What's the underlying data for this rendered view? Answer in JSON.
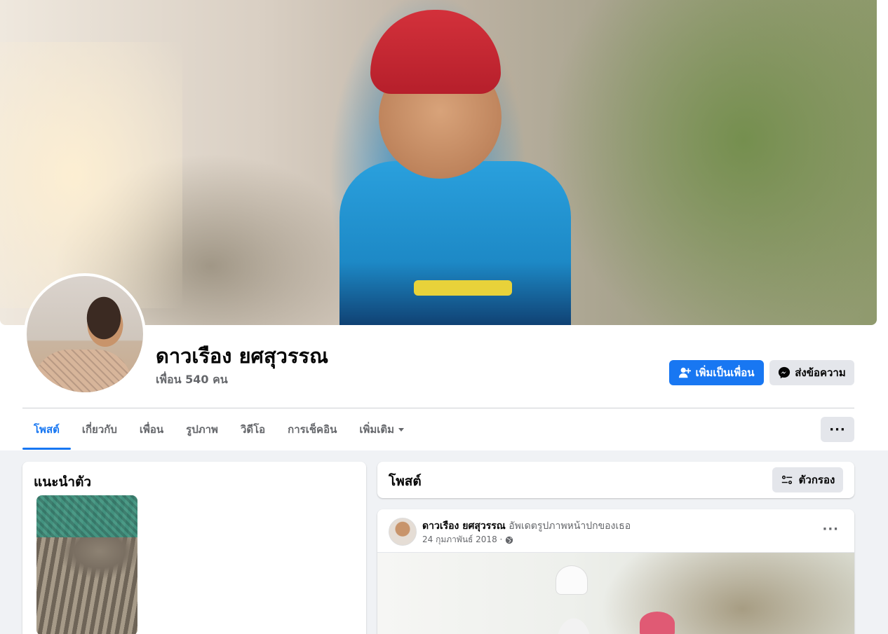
{
  "profile": {
    "name": "ดาวเรือง ยศสุวรรณ",
    "friends_label": "เพื่อน 540 คน"
  },
  "actions": {
    "add_friend": "เพิ่มเป็นเพื่อน",
    "message": "ส่งข้อความ"
  },
  "tabs": [
    {
      "label": "โพสต์",
      "active": true
    },
    {
      "label": "เกี่ยวกับ",
      "active": false
    },
    {
      "label": "เพื่อน",
      "active": false
    },
    {
      "label": "รูปภาพ",
      "active": false
    },
    {
      "label": "วิดีโอ",
      "active": false
    },
    {
      "label": "การเช็คอิน",
      "active": false
    },
    {
      "label": "เพิ่มเติม",
      "active": false
    }
  ],
  "more_button": "···",
  "intro": {
    "title": "แนะนำตัว"
  },
  "posts": {
    "title": "โพสต์",
    "filter_label": "ตัวกรอง"
  },
  "post": {
    "author": "ดาวเรือง ยศสุวรรณ",
    "action": "อัพเดตรูปภาพหน้าปกของเธอ",
    "date": "24 กุมภาพันธ์ 2018 ·",
    "more": "···"
  },
  "colors": {
    "accent": "#1877f2",
    "background": "#f0f2f5",
    "secondary_button": "#e4e6eb",
    "muted_text": "#65676b"
  }
}
